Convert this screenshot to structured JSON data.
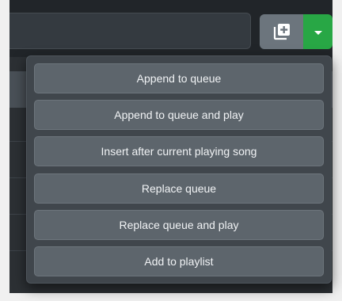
{
  "toolbar": {
    "add_icon": "add-to-queue-icon",
    "toggle_icon": "caret-down-icon"
  },
  "menu": {
    "items": [
      {
        "label": "Append to queue"
      },
      {
        "label": "Append to queue and play"
      },
      {
        "label": "Insert after current playing song"
      },
      {
        "label": "Replace queue"
      },
      {
        "label": "Replace queue and play"
      },
      {
        "label": "Add to playlist"
      }
    ]
  },
  "colors": {
    "page_background": "#2c3034",
    "button_secondary": "#6c757d",
    "button_success": "#28a745",
    "menu_background": "#40464c",
    "menu_item_background": "#5d656c",
    "menu_text": "#f1f3f5"
  }
}
